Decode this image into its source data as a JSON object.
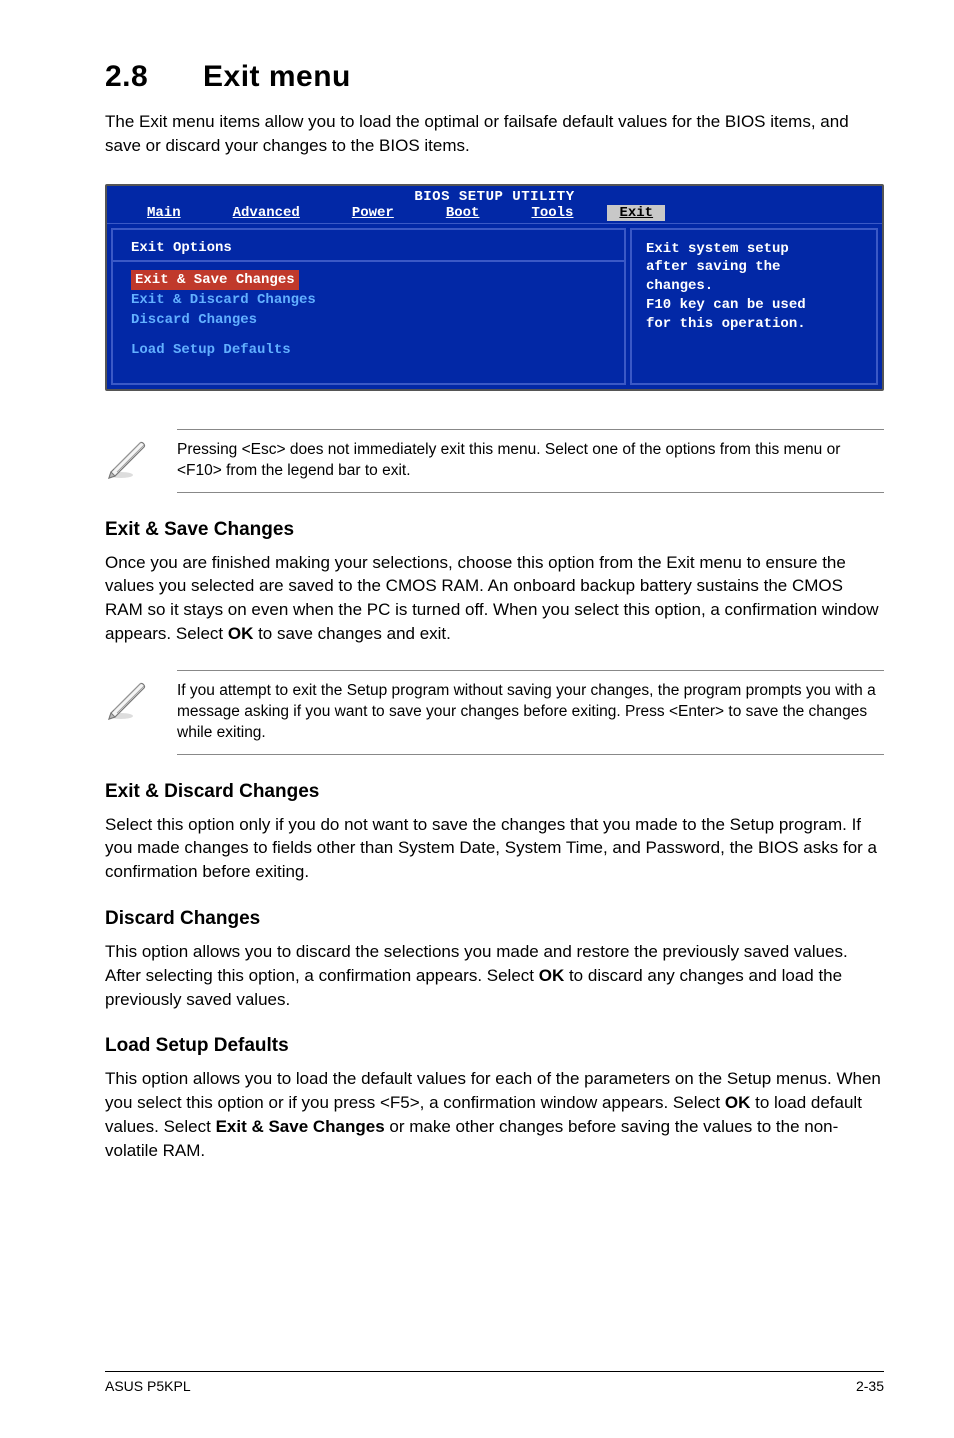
{
  "title_num": "2.8",
  "title_text": "Exit menu",
  "intro": "The Exit menu items allow you to load the optimal or failsafe default values for the BIOS items, and save or discard your changes to the BIOS items.",
  "bios": {
    "header": "BIOS SETUP UTILITY",
    "tabs": [
      "Main",
      "Advanced",
      "Power",
      "Boot",
      "Tools",
      "Exit"
    ],
    "left_header": "Exit Options",
    "items": [
      "Exit & Save Changes",
      "Exit & Discard Changes",
      "Discard Changes",
      "Load Setup Defaults"
    ],
    "help_lines": [
      "Exit system setup",
      "after saving the",
      "changes.",
      "",
      "F10 key can be used",
      "for this operation."
    ]
  },
  "note1": "Pressing <Esc> does not immediately exit this menu. Select one of the options from this menu or <F10> from the legend bar to exit.",
  "sec1_h": "Exit & Save Changes",
  "sec1_p_a": "Once you are finished making your selections, choose this option from the Exit menu to ensure the values you selected are saved to the CMOS RAM. An onboard backup battery sustains the CMOS RAM so it stays on even when the PC is turned off. When you select this option, a confirmation window appears. Select ",
  "sec1_p_ok": "OK",
  "sec1_p_b": " to save changes and exit.",
  "note2": " If you attempt to exit the Setup program without saving your changes, the program prompts you with a message asking if you want to save your changes before exiting. Press <Enter>  to save the  changes while exiting.",
  "sec2_h": "Exit & Discard Changes",
  "sec2_p": "Select this option only if you do not want to save the changes that you  made to the Setup program. If you made changes to fields other than System Date, System Time, and Password, the BIOS asks for a confirmation before exiting.",
  "sec3_h": "Discard Changes",
  "sec3_p_a": "This option allows you to discard the selections you made and restore the previously saved values. After selecting this option, a confirmation appears. Select ",
  "sec3_p_ok": "OK",
  "sec3_p_b": " to discard any changes and load the previously saved values.",
  "sec4_h": "Load Setup Defaults",
  "sec4_p_a": "This option allows you to load the default values for each of the parameters on the Setup menus. When you select this option or if you press <F5>, a confirmation window appears. Select ",
  "sec4_p_ok": "OK",
  "sec4_p_b": " to load default values. Select ",
  "sec4_p_exit": "Exit & Save Changes",
  "sec4_p_c": " or make other changes before saving the values to the non-volatile RAM.",
  "footer_left": "ASUS P5KPL",
  "footer_right": "2-35"
}
